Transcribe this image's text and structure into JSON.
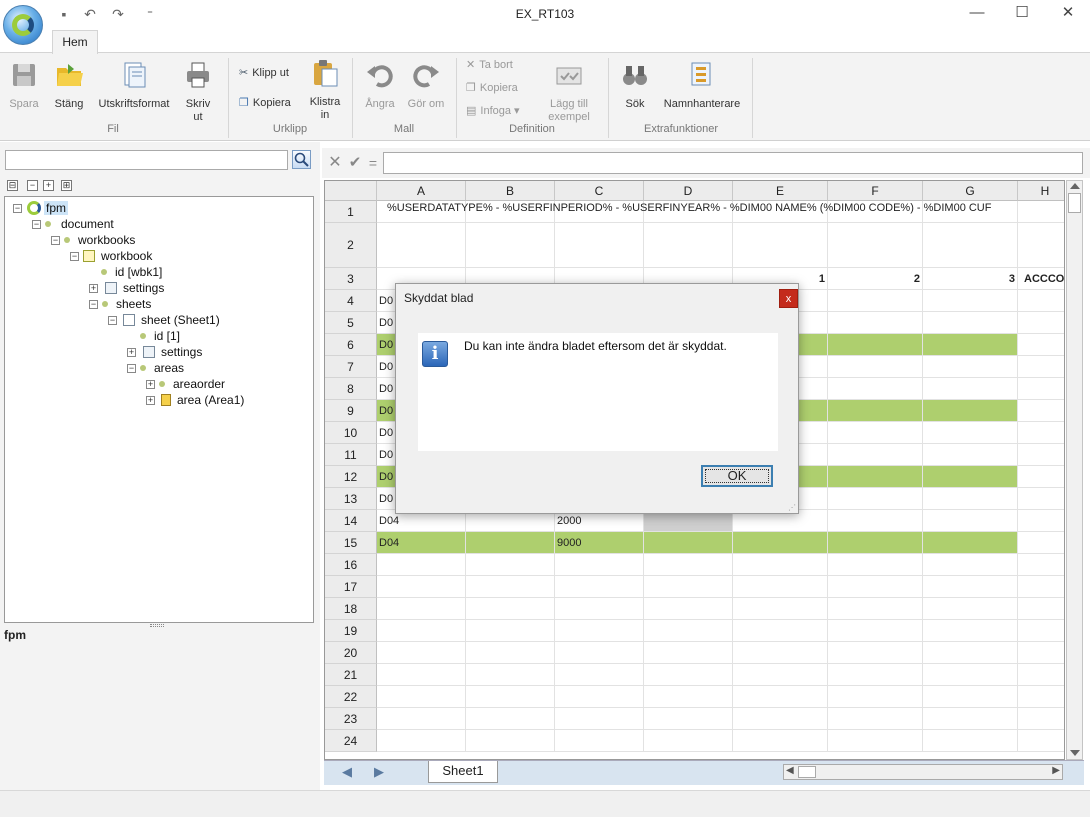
{
  "window": {
    "title": "EX_RT103"
  },
  "ribbon": {
    "tab": "Hem",
    "fil": {
      "label": "Fil",
      "spara": "Spara",
      "stang": "Stäng",
      "utskriftsformat": "Utskriftsformat",
      "skriv_ut": "Skriv ut"
    },
    "urklipp": {
      "label": "Urklipp",
      "klipp_ut": "Klipp ut",
      "kopiera": "Kopiera",
      "klistra_in": "Klistra in"
    },
    "mall": {
      "label": "Mall",
      "angra": "Ångra",
      "gor_om": "Gör om"
    },
    "definition": {
      "label": "Definition",
      "ta_bort": "Ta bort",
      "kopiera": "Kopiera",
      "infoga": "Infoga",
      "lagg_till": "Lägg till exempel"
    },
    "extra": {
      "label": "Extrafunktioner",
      "sok": "Sök",
      "namnhanterare": "Namnhanterare"
    }
  },
  "tree": {
    "nodes": [
      {
        "label": "fpm"
      },
      {
        "label": "document"
      },
      {
        "label": "workbooks"
      },
      {
        "label": "workbook"
      },
      {
        "label": "id [wbk1]"
      },
      {
        "label": "settings"
      },
      {
        "label": "sheets"
      },
      {
        "label": "sheet (Sheet1)"
      },
      {
        "label": "id [1]"
      },
      {
        "label": "settings"
      },
      {
        "label": "areas"
      },
      {
        "label": "areaorder"
      },
      {
        "label": "area (Area1)"
      }
    ]
  },
  "left_status": "fpm",
  "formula": {
    "value": ""
  },
  "grid": {
    "columns": [
      "A",
      "B",
      "C",
      "D",
      "E",
      "F",
      "G",
      "H"
    ],
    "rows": [
      "1",
      "2",
      "3",
      "4",
      "5",
      "6",
      "7",
      "8",
      "9",
      "10",
      "11",
      "12",
      "13",
      "14",
      "15",
      "16",
      "17",
      "18",
      "19",
      "20",
      "21",
      "22",
      "23",
      "24"
    ],
    "row1_text": "%USERDATATYPE% - %USERFINPERIOD% - %USERFINYEAR% - %DIM00 NAME% (%DIM00 CODE%) - %DIM00 CUF",
    "row3": {
      "e": "1",
      "f": "2",
      "g": "3",
      "h": "ACCCO"
    },
    "col_a": [
      "D0",
      "D0",
      "D0",
      "D0",
      "D0",
      "D0",
      "D0",
      "D0",
      "D0",
      "D0",
      "D04",
      "D04"
    ],
    "c14": "2000",
    "c15": "9000"
  },
  "sheet_tab": "Sheet1",
  "dialog": {
    "title": "Skyddat blad",
    "close": "x",
    "message": "Du kan inte ändra bladet eftersom det är skyddat.",
    "ok": "OK",
    "icon": "i"
  },
  "colors": {
    "highlight_row": "#aecf6e",
    "accent": "#3c7fb1"
  }
}
